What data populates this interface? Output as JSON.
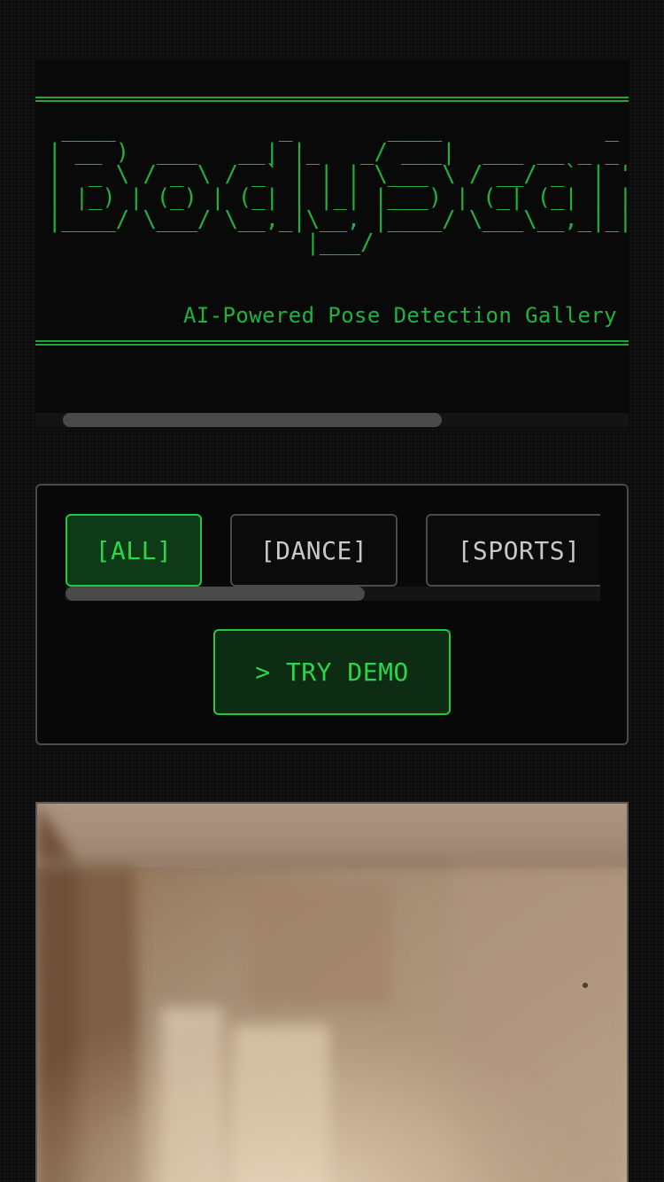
{
  "header": {
    "ascii_logo": " ____            _       ____            _\n| __ )  ___   __| |_   _/ ___|  ___ __ _ _ __ (_)\n|  _ \\ / _ \\ / _` | | | \\___ \\ / __/ _` | '_ \\| |\n| |_) | (_) | (_| | |_| |___) | (_| (_| | | | | |\n|____/ \\___/ \\__,_|\\__, |____/ \\___\\__,_|_| |_|_|\n                   |___/                          |",
    "logo_text": "BodyScan",
    "subtitle": "AI-Powered Pose Detection Gallery",
    "scroll_position": 0.1
  },
  "filters": {
    "items": [
      {
        "label": "[ALL]",
        "active": true
      },
      {
        "label": "[DANCE]",
        "active": false
      },
      {
        "label": "[SPORTS]",
        "active": false
      }
    ],
    "scroll_position": 0
  },
  "demo_button": {
    "label": "> TRY DEMO"
  },
  "colors": {
    "accent": "#22c93f",
    "accent_text": "#2bd64a",
    "background": "#0c0c0c",
    "panel_border": "#4a4a4a"
  },
  "gallery": {
    "items": [
      {
        "media": "photo",
        "description_hidden": true
      }
    ]
  }
}
